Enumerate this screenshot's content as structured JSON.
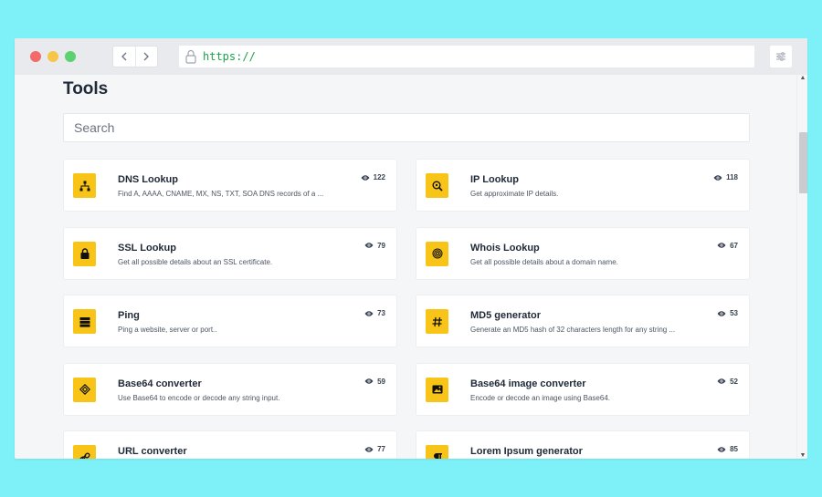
{
  "browser": {
    "url": "https://"
  },
  "page": {
    "title": "Tools",
    "search_placeholder": "Search"
  },
  "tools": [
    {
      "name": "DNS Lookup",
      "description": "Find A, AAAA, CNAME, MX, NS, TXT, SOA DNS records of a ...",
      "views": "122",
      "icon": "sitemap-icon"
    },
    {
      "name": "IP Lookup",
      "description": "Get approximate IP details.",
      "views": "118",
      "icon": "search-location-icon"
    },
    {
      "name": "SSL Lookup",
      "description": "Get all possible details about an SSL certificate.",
      "views": "79",
      "icon": "lock-icon"
    },
    {
      "name": "Whois Lookup",
      "description": "Get all possible details about a domain name.",
      "views": "67",
      "icon": "fingerprint-icon"
    },
    {
      "name": "Ping",
      "description": "Ping a website, server or port..",
      "views": "73",
      "icon": "server-icon"
    },
    {
      "name": "MD5 generator",
      "description": "Generate an MD5 hash of 32 characters length for any string ...",
      "views": "53",
      "icon": "hashtag-icon"
    },
    {
      "name": "Base64 converter",
      "description": "Use Base64 to encode or decode any string input.",
      "views": "59",
      "icon": "code-icon"
    },
    {
      "name": "Base64 image converter",
      "description": "Encode or decode an image using Base64.",
      "views": "52",
      "icon": "image-icon"
    },
    {
      "name": "URL converter",
      "description": "",
      "views": "77",
      "icon": "link-icon"
    },
    {
      "name": "Lorem Ipsum generator",
      "description": "",
      "views": "85",
      "icon": "paragraph-icon"
    }
  ],
  "colors": {
    "accent": "#f7c417",
    "url_green": "#1aa34a",
    "background": "#7ef1f8"
  }
}
